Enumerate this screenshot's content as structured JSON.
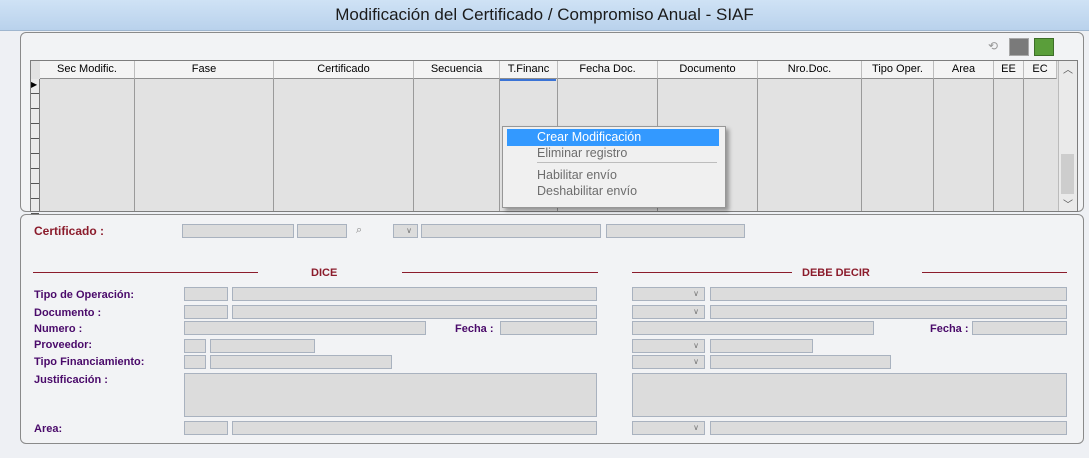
{
  "window": {
    "title": "Modificación del Certificado /  Compromiso  Anual  - SIAF"
  },
  "grid": {
    "columns": [
      "Sec Modific.",
      "Fase",
      "Certificado",
      "Secuencia",
      "T.Financ",
      "Fecha Doc.",
      "Documento",
      "Nro.Doc.",
      "Tipo Oper.",
      "Area",
      "EE",
      "EC"
    ]
  },
  "context_menu": {
    "items": [
      "Crear Modificación",
      "Eliminar registro",
      "Habilitar envío",
      "Deshabilitar envío"
    ]
  },
  "form": {
    "certificado_label": "Certificado :",
    "dice": "DICE",
    "debe_decir": "DEBE DECIR",
    "tipo_operacion": "Tipo de Operación:",
    "documento": "Documento :",
    "numero": "Numero :",
    "fecha": "Fecha :",
    "proveedor": "Proveedor:",
    "tipo_financiamiento": "Tipo Financiamiento:",
    "justificacion": "Justificación :",
    "area": "Area:"
  },
  "icons": {
    "undo": "undo-icon",
    "grid": "grid-icon",
    "exit": "exit-icon",
    "binoculars": "binoculars-icon"
  },
  "colors": {
    "section": "#8b1b2b",
    "label": "#4a0a6a",
    "selection": "#3399ff"
  }
}
